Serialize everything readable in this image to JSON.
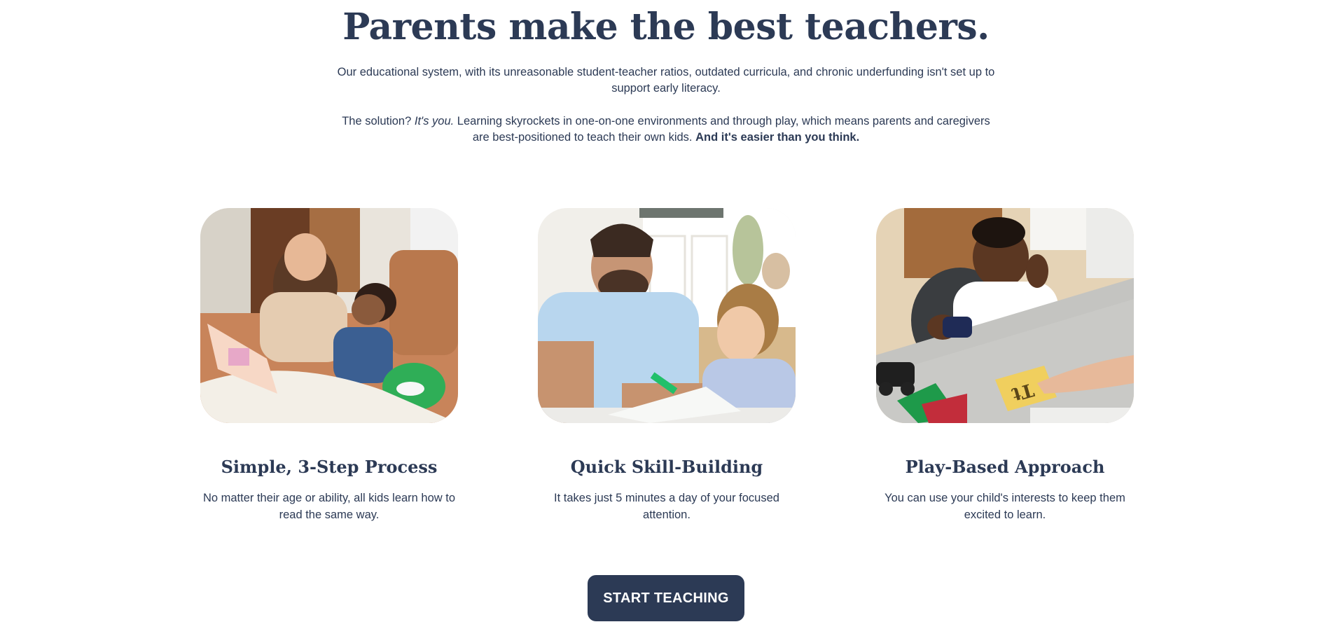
{
  "hero": {
    "title": "Parents make the best teachers.",
    "intro_1": "Our educational system, with its unreasonable student-teacher ratios, outdated curricula, and chronic underfunding isn't set up to support early literacy.",
    "intro_2_start": "The solution? ",
    "intro_2_italic": "It's you.",
    "intro_2_mid": " Learning skyrockets in one-on-one environments and through play, which means parents and caregivers are best-positioned to teach their own kids. ",
    "intro_2_bold": "And it's easier than you think."
  },
  "features": [
    {
      "title": "Simple, 3-Step Process",
      "text": "No matter their age or ability, all kids learn how to read the same way.",
      "image": "mother-reading-with-daughter-photo"
    },
    {
      "title": "Quick Skill-Building",
      "text": "It takes just 5 minutes a day of your focused attention.",
      "image": "father-writing-with-son-photo"
    },
    {
      "title": "Play-Based Approach",
      "text": "You can use your child's interests to keep them excited to learn.",
      "image": "boy-playing-with-letter-card-photo",
      "card_letters": "Tt"
    }
  ],
  "cta": {
    "label": "START TEACHING"
  },
  "colors": {
    "navy": "#2c3a55",
    "background": "#ffffff"
  }
}
